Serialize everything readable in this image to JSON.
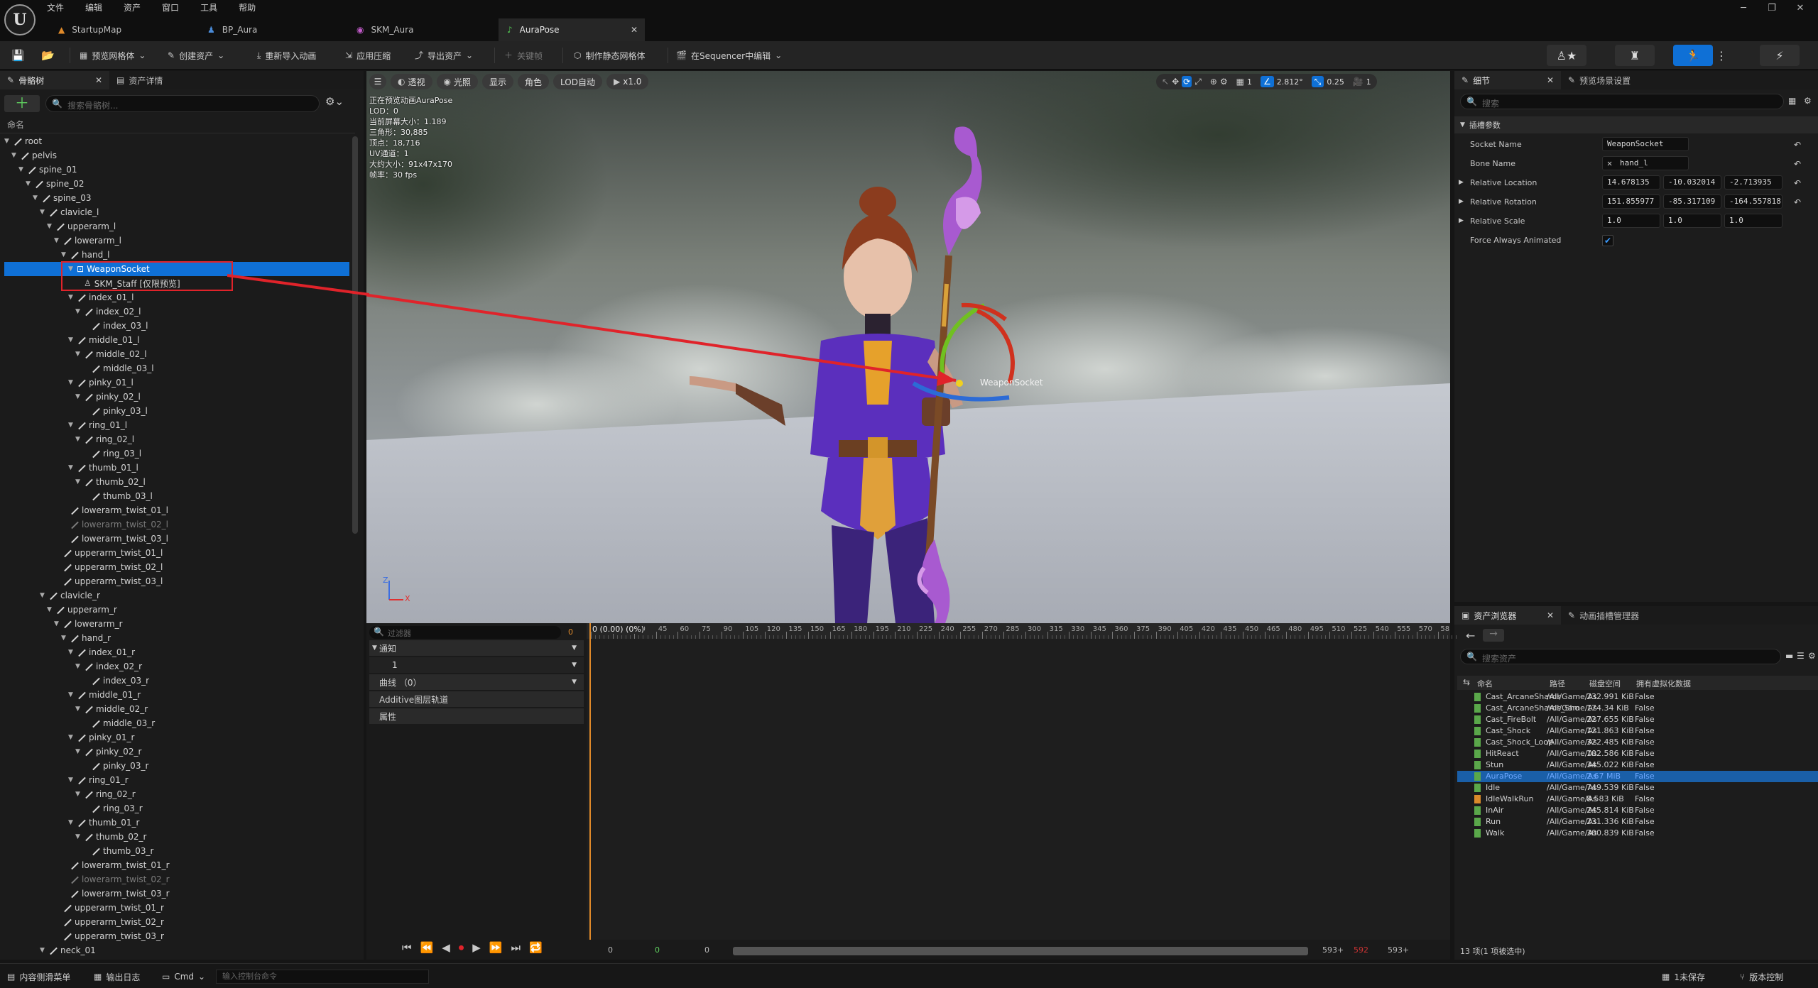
{
  "menu": [
    "文件",
    "编辑",
    "资产",
    "窗口",
    "工具",
    "帮助"
  ],
  "tabs": [
    {
      "label": "StartupMap",
      "active": false
    },
    {
      "label": "BP_Aura",
      "active": false
    },
    {
      "label": "SKM_Aura",
      "active": false
    },
    {
      "label": "AuraPose",
      "active": true
    }
  ],
  "toolbar": {
    "preview_mesh": "预览网格体",
    "create_asset": "创建资产",
    "reimport": "重新导入动画",
    "apply_compression": "应用压缩",
    "export_asset": "导出资产",
    "keyframe": "关键帧",
    "make_static_mesh": "制作静态网格体",
    "edit_in_sequencer": "在Sequencer中编辑"
  },
  "left_panel": {
    "tab_skeleton": "骨骼树",
    "tab_asset_details": "资产详情",
    "search_placeholder": "搜索骨骼树...",
    "column_name": "命名"
  },
  "skeleton_tree": [
    {
      "label": "root",
      "depth": 0,
      "arrow": true
    },
    {
      "label": "pelvis",
      "depth": 1,
      "arrow": true
    },
    {
      "label": "spine_01",
      "depth": 2,
      "arrow": true
    },
    {
      "label": "spine_02",
      "depth": 3,
      "arrow": true
    },
    {
      "label": "spine_03",
      "depth": 4,
      "arrow": true
    },
    {
      "label": "clavicle_l",
      "depth": 5,
      "arrow": true
    },
    {
      "label": "upperarm_l",
      "depth": 6,
      "arrow": true
    },
    {
      "label": "lowerarm_l",
      "depth": 7,
      "arrow": true
    },
    {
      "label": "hand_l",
      "depth": 8,
      "arrow": true
    },
    {
      "label": "WeaponSocket",
      "depth": 9,
      "arrow": true,
      "selected": true,
      "type": "socket"
    },
    {
      "label": "SKM_Staff [仅限预览]",
      "depth": 10,
      "type": "mesh"
    },
    {
      "label": "index_01_l",
      "depth": 9,
      "arrow": true
    },
    {
      "label": "index_02_l",
      "depth": 10,
      "arrow": true
    },
    {
      "label": "index_03_l",
      "depth": 11
    },
    {
      "label": "middle_01_l",
      "depth": 9,
      "arrow": true
    },
    {
      "label": "middle_02_l",
      "depth": 10,
      "arrow": true
    },
    {
      "label": "middle_03_l",
      "depth": 11
    },
    {
      "label": "pinky_01_l",
      "depth": 9,
      "arrow": true
    },
    {
      "label": "pinky_02_l",
      "depth": 10,
      "arrow": true
    },
    {
      "label": "pinky_03_l",
      "depth": 11
    },
    {
      "label": "ring_01_l",
      "depth": 9,
      "arrow": true
    },
    {
      "label": "ring_02_l",
      "depth": 10,
      "arrow": true
    },
    {
      "label": "ring_03_l",
      "depth": 11
    },
    {
      "label": "thumb_01_l",
      "depth": 9,
      "arrow": true
    },
    {
      "label": "thumb_02_l",
      "depth": 10,
      "arrow": true
    },
    {
      "label": "thumb_03_l",
      "depth": 11
    },
    {
      "label": "lowerarm_twist_01_l",
      "depth": 8
    },
    {
      "label": "lowerarm_twist_02_l",
      "depth": 8,
      "dim": true
    },
    {
      "label": "lowerarm_twist_03_l",
      "depth": 8
    },
    {
      "label": "upperarm_twist_01_l",
      "depth": 7
    },
    {
      "label": "upperarm_twist_02_l",
      "depth": 7
    },
    {
      "label": "upperarm_twist_03_l",
      "depth": 7
    },
    {
      "label": "clavicle_r",
      "depth": 5,
      "arrow": true
    },
    {
      "label": "upperarm_r",
      "depth": 6,
      "arrow": true
    },
    {
      "label": "lowerarm_r",
      "depth": 7,
      "arrow": true
    },
    {
      "label": "hand_r",
      "depth": 8,
      "arrow": true
    },
    {
      "label": "index_01_r",
      "depth": 9,
      "arrow": true
    },
    {
      "label": "index_02_r",
      "depth": 10,
      "arrow": true
    },
    {
      "label": "index_03_r",
      "depth": 11
    },
    {
      "label": "middle_01_r",
      "depth": 9,
      "arrow": true
    },
    {
      "label": "middle_02_r",
      "depth": 10,
      "arrow": true
    },
    {
      "label": "middle_03_r",
      "depth": 11
    },
    {
      "label": "pinky_01_r",
      "depth": 9,
      "arrow": true
    },
    {
      "label": "pinky_02_r",
      "depth": 10,
      "arrow": true
    },
    {
      "label": "pinky_03_r",
      "depth": 11
    },
    {
      "label": "ring_01_r",
      "depth": 9,
      "arrow": true
    },
    {
      "label": "ring_02_r",
      "depth": 10,
      "arrow": true
    },
    {
      "label": "ring_03_r",
      "depth": 11
    },
    {
      "label": "thumb_01_r",
      "depth": 9,
      "arrow": true
    },
    {
      "label": "thumb_02_r",
      "depth": 10,
      "arrow": true
    },
    {
      "label": "thumb_03_r",
      "depth": 11
    },
    {
      "label": "lowerarm_twist_01_r",
      "depth": 8
    },
    {
      "label": "lowerarm_twist_02_r",
      "depth": 8,
      "dim": true
    },
    {
      "label": "lowerarm_twist_03_r",
      "depth": 8
    },
    {
      "label": "upperarm_twist_01_r",
      "depth": 7
    },
    {
      "label": "upperarm_twist_02_r",
      "depth": 7
    },
    {
      "label": "upperarm_twist_03_r",
      "depth": 7
    },
    {
      "label": "neck_01",
      "depth": 5,
      "arrow": true
    }
  ],
  "viewport": {
    "buttons": [
      "透视",
      "光照",
      "显示",
      "角色",
      "LOD自动",
      "x1.0"
    ],
    "stats": [
      "正在预览动画AuraPose",
      "LOD：0",
      "当前屏幕大小：1.189",
      "三角形：30,885",
      "顶点：18,716",
      "UV通道：1",
      "大约大小：91x47x170",
      "帧率：30 fps"
    ],
    "right_values": [
      "1",
      "2.812°",
      "0.25",
      "1"
    ],
    "socket_label": "WeaponSocket",
    "axis_z": "Z",
    "axis_x": "X"
  },
  "details": {
    "tab_details": "细节",
    "tab_preview_settings": "预览场景设置",
    "search_placeholder": "搜索",
    "section": "插槽参数",
    "socket_name_label": "Socket Name",
    "socket_name_value": "WeaponSocket",
    "bone_name_label": "Bone Name",
    "bone_name_value": "hand_l",
    "rel_location_label": "Relative Location",
    "rel_location": [
      "14.678135",
      "-10.032014",
      "-2.713935"
    ],
    "rel_rotation_label": "Relative Rotation",
    "rel_rotation": [
      "151.855977",
      "-85.317109",
      "-164.557818"
    ],
    "rel_scale_label": "Relative Scale",
    "rel_scale": [
      "1.0",
      "1.0",
      "1.0"
    ],
    "force_anim_label": "Force Always Animated"
  },
  "asset_browser": {
    "tab_assets": "资产浏览器",
    "tab_anim_slots": "动画插槽管理器",
    "search_placeholder": "搜索资产",
    "columns": [
      "命名",
      "路径",
      "磁盘空间",
      "拥有虚拟化数据"
    ],
    "rows": [
      {
        "name": "Cast_ArcaneShards",
        "path": "/All/Game/As",
        "size": "232.991 KiB",
        "virt": "False"
      },
      {
        "name": "Cast_ArcaneShards_Sho",
        "path": "/All/Game/As",
        "size": "174.34 KiB",
        "virt": "False"
      },
      {
        "name": "Cast_FireBolt",
        "path": "/All/Game/As",
        "size": "227.655 KiB",
        "virt": "False"
      },
      {
        "name": "Cast_Shock",
        "path": "/All/Game/As",
        "size": "121.863 KiB",
        "virt": "False"
      },
      {
        "name": "Cast_Shock_Loop",
        "path": "/All/Game/As",
        "size": "322.485 KiB",
        "virt": "False"
      },
      {
        "name": "HitReact",
        "path": "/All/Game/As",
        "size": "102.586 KiB",
        "virt": "False"
      },
      {
        "name": "Stun",
        "path": "/All/Game/As",
        "size": "345.022 KiB",
        "virt": "False"
      },
      {
        "name": "AuraPose",
        "path": "/All/Game/As",
        "size": "2.67 MiB",
        "virt": "False",
        "selected": true
      },
      {
        "name": "Idle",
        "path": "/All/Game/As",
        "size": "749.539 KiB",
        "virt": "False"
      },
      {
        "name": "IdleWalkRun",
        "path": "/All/Game/As",
        "size": "8.583 KiB",
        "virt": "False",
        "orange": true
      },
      {
        "name": "InAir",
        "path": "/All/Game/As",
        "size": "245.814 KiB",
        "virt": "False"
      },
      {
        "name": "Run",
        "path": "/All/Game/As",
        "size": "231.336 KiB",
        "virt": "False"
      },
      {
        "name": "Walk",
        "path": "/All/Game/As",
        "size": "300.839 KiB",
        "virt": "False"
      }
    ],
    "footer": "13 项(1 项被选中)"
  },
  "timeline": {
    "filter_placeholder": "过滤器",
    "filter_count": "0",
    "tracks": [
      "通知",
      "1",
      "曲线 （0）",
      "Additive图层轨道",
      "属性"
    ],
    "current_frame": "0 (0.00) (0%)",
    "ticks": [
      "0",
      "15",
      "30",
      "45",
      "60",
      "75",
      "90",
      "105",
      "120",
      "135",
      "150",
      "165",
      "180",
      "195",
      "210",
      "225",
      "240",
      "255",
      "270",
      "285",
      "300",
      "315",
      "330",
      "345",
      "360",
      "375",
      "390",
      "405",
      "420",
      "435",
      "450",
      "465",
      "480",
      "495",
      "510",
      "525",
      "540",
      "555",
      "570",
      "58"
    ],
    "bottom": {
      "start": "0",
      "mid": "0",
      "mid2": "0",
      "end1": "593+",
      "end2": "593+"
    }
  },
  "statusbar": {
    "content_drawer": "内容侧滑菜单",
    "output_log": "输出日志",
    "cmd": "Cmd",
    "console_placeholder": "输入控制台命令",
    "unsaved": "1未保存",
    "source_control": "版本控制"
  },
  "colors": {
    "accent": "#0f70d6",
    "selected_row": "#1a5fa8",
    "highlight_red": "#e0232a"
  }
}
